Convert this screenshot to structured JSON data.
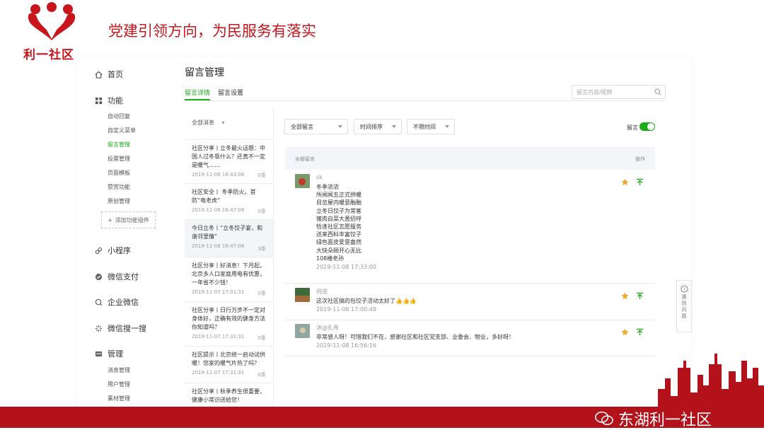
{
  "slide": {
    "logo_text": "利一社区",
    "slogan": "党建引领方向，为民服务有落实",
    "footer_brand": "东湖利一社区"
  },
  "sidebar": {
    "main_items": [
      {
        "label": "首页",
        "icon": "home-icon"
      },
      {
        "label": "功能",
        "icon": "grid-icon"
      },
      {
        "label": "小程序",
        "icon": "mini-program-icon"
      },
      {
        "label": "微信支付",
        "icon": "wechat-pay-icon"
      },
      {
        "label": "企业微信",
        "icon": "enterprise-wechat-icon"
      },
      {
        "label": "微信搜一搜",
        "icon": "search-one-icon"
      },
      {
        "label": "管理",
        "icon": "manage-icon"
      }
    ],
    "function_sub": [
      "自动回复",
      "自定义菜单",
      "留言管理",
      "投票管理",
      "页面模板",
      "赞赏功能",
      "原创管理"
    ],
    "add_plugin": "添加功能插件",
    "manage_sub": [
      "消息管理",
      "用户管理",
      "素材管理"
    ]
  },
  "header": {
    "page_title": "留言管理",
    "tabs": [
      "留言详情",
      "留言设置"
    ],
    "search_placeholder": "留言内容/昵称"
  },
  "message_list": {
    "filter_label": "全部消息",
    "items": [
      {
        "lines": [
          "社区分享丨立冬最火话题：中",
          "国人过冬靠什么？还真不一定",
          "是暖气……"
        ],
        "date": "2019-11-08 16:43:08",
        "count": "0条"
      },
      {
        "lines": [
          "社区安全丨 冬季防火，首",
          "防“电老虎”"
        ],
        "date": "2019-11-08 16:47:08",
        "count": "0条"
      },
      {
        "lines": [
          "今日立冬丨“立冬饺子宴，和",
          "谐邻里情”"
        ],
        "date": "2019-11-08 16:47:08",
        "count": "3条"
      },
      {
        "lines": [
          "社区分享丨好消息！下月起，",
          "北京多人口家庭用电有优惠，",
          "一年省不少钱！"
        ],
        "date": "2019-11-07 17:31:31",
        "count": "0条"
      },
      {
        "lines": [
          "社区分享丨日行万步不一定对",
          "身体好，正确有效的健身方法",
          "你知道吗？"
        ],
        "date": "2019-11-07 17:31:31",
        "count": "0条"
      },
      {
        "lines": [
          "社区提示丨北京统一启动试供",
          "暖！您家的暖气片热了吗？"
        ],
        "date": "2019-11-07 17:31:31",
        "count": "0条"
      },
      {
        "lines": [
          "社区分享丨秋季养生很重要，",
          "健康小常识送给您！"
        ],
        "date": "",
        "count": ""
      }
    ]
  },
  "filters": {
    "dropdowns": [
      "全部留言",
      "时间排序",
      "不限时间"
    ],
    "toggle_label": "留言",
    "toggle_on": true
  },
  "table": {
    "header_left": "全部留言",
    "header_right": "操作"
  },
  "comments": [
    {
      "name": "sk",
      "lines": [
        "冬季浓浓",
        "所闻闻五正式供暖",
        "目览屋内暖意融融",
        "立冬日饺子为常客",
        "猪肉白菜大葱招呼",
        "恰逢社区志愿服务",
        "送来西料丰富饺子",
        "绿色面皮爱意盎然",
        "大快朵颐开心无比",
        "108楼老孙"
      ],
      "date": "2019-11-08 17:33:00"
    },
    {
      "name": "同逆",
      "lines": [
        "这次社区搞的包饺子活动太好了👍👍👍"
      ],
      "date": "2019-11-08 17:00:48"
    },
    {
      "name": "沐@扎布",
      "lines": [
        "非常感人呀！可惜我们不在，感谢社区和社区党支部、业委会、物业，多好呀！"
      ],
      "date": "2019-11-08 16:56:16"
    }
  ],
  "helper": {
    "label_chars": [
      "遇",
      "到",
      "问",
      "题"
    ]
  },
  "colors": {
    "brand_red": "#c8161d",
    "accent_green": "#1aad19",
    "star_yellow": "#f5a623"
  }
}
